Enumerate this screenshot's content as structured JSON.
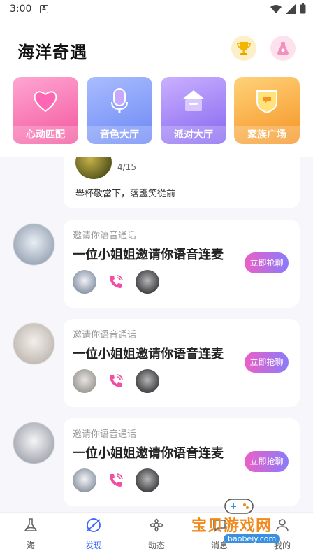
{
  "status": {
    "time": "3:00",
    "notify_glyph": "A"
  },
  "header": {
    "title": "海洋奇遇",
    "icons": [
      "trophy-icon",
      "potion-icon"
    ]
  },
  "categories": [
    {
      "label": "心动匹配",
      "icon": "heart-icon",
      "color_from": "#ff8fc8",
      "color_to": "#f45aa0"
    },
    {
      "label": "音色大厅",
      "icon": "microphone-icon",
      "color_from": "#9bb3ff",
      "color_to": "#6f8cf5"
    },
    {
      "label": "派对大厅",
      "icon": "house-icon",
      "color_from": "#c9a7ff",
      "color_to": "#8d6cf2"
    },
    {
      "label": "家族广场",
      "icon": "shield-icon",
      "color_from": "#ffce6b",
      "color_to": "#f79a2a"
    }
  ],
  "feed": {
    "partial_post": {
      "date": "4/15",
      "text": "舉杯敬當下，落盞笑從前"
    },
    "invites": [
      {
        "subtitle": "邀请你语音通话",
        "title": "一位小姐姐邀请你语音连麦",
        "button": "立即抢聊"
      },
      {
        "subtitle": "邀请你语音通话",
        "title": "一位小姐姐邀请你语音连麦",
        "button": "立即抢聊"
      },
      {
        "subtitle": "邀请你语音通话",
        "title": "一位小姐姐邀请你语音连麦",
        "button": "立即抢聊"
      }
    ]
  },
  "tabs": [
    {
      "label": "海",
      "icon": "sea-icon",
      "active": false
    },
    {
      "label": "发现",
      "icon": "compass-icon",
      "active": true
    },
    {
      "label": "动态",
      "icon": "flower-icon",
      "active": false
    },
    {
      "label": "消息",
      "icon": "message-icon",
      "active": false
    },
    {
      "label": "我的",
      "icon": "profile-icon",
      "active": false
    }
  ],
  "watermark": {
    "text": "宝贝游戏网",
    "url": "baobeiy.com"
  },
  "colors": {
    "accent": "#3c64ff",
    "button_from": "#ec5fc6",
    "button_to": "#8b7bfb"
  }
}
